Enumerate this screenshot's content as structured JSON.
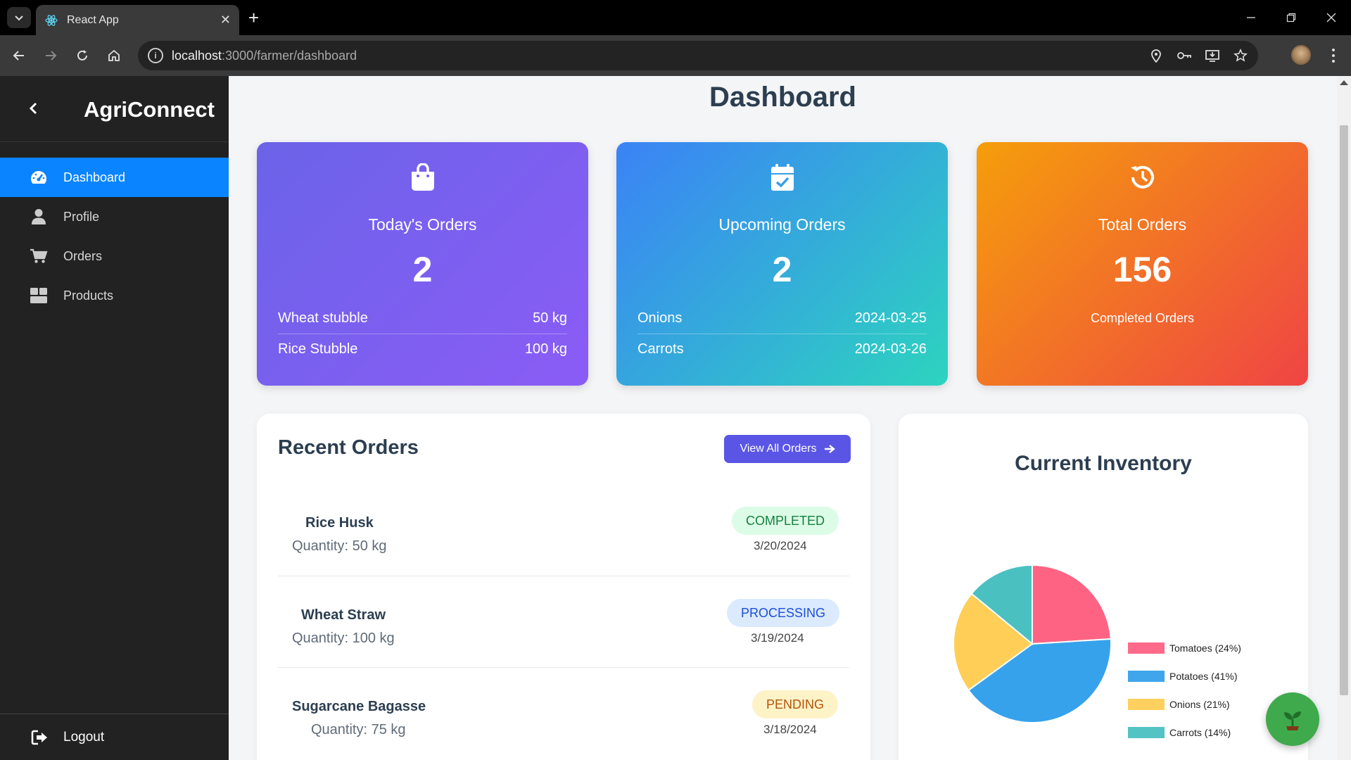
{
  "browser": {
    "tab_title": "React App",
    "url_host": "localhost",
    "url_path": ":3000/farmer/dashboard"
  },
  "sidebar": {
    "brand": "AgriConnect",
    "items": [
      {
        "label": "Dashboard",
        "icon": "gauge-icon",
        "active": true
      },
      {
        "label": "Profile",
        "icon": "user-icon",
        "active": false
      },
      {
        "label": "Orders",
        "icon": "cart-icon",
        "active": false
      },
      {
        "label": "Products",
        "icon": "boxes-icon",
        "active": false
      }
    ],
    "logout": "Logout"
  },
  "page": {
    "title": "Dashboard"
  },
  "cards": {
    "today": {
      "label": "Today's Orders",
      "value": "2",
      "rows": [
        {
          "left": "Wheat stubble",
          "right": "50 kg"
        },
        {
          "left": "Rice Stubble",
          "right": "100 kg"
        }
      ]
    },
    "upcoming": {
      "label": "Upcoming Orders",
      "value": "2",
      "rows": [
        {
          "left": "Onions",
          "right": "2024-03-25"
        },
        {
          "left": "Carrots",
          "right": "2024-03-26"
        }
      ]
    },
    "total": {
      "label": "Total Orders",
      "value": "156",
      "sub": "Completed Orders"
    }
  },
  "recent_orders": {
    "title": "Recent Orders",
    "view_all": "View All Orders",
    "orders": [
      {
        "name": "Rice Husk",
        "quantity": "Quantity: 50 kg",
        "status": "COMPLETED",
        "date": "3/20/2024"
      },
      {
        "name": "Wheat Straw",
        "quantity": "Quantity: 100 kg",
        "status": "PROCESSING",
        "date": "3/19/2024"
      },
      {
        "name": "Sugarcane Bagasse",
        "quantity": "Quantity: 75 kg",
        "status": "PENDING",
        "date": "3/18/2024"
      }
    ]
  },
  "inventory": {
    "title": "Current Inventory"
  },
  "colors": {
    "accent": "#0a84ff",
    "completed_bg": "#dcfce7",
    "completed_fg": "#15803d",
    "processing_bg": "#dbeafe",
    "processing_fg": "#1d4ed8",
    "pending_bg": "#fef3c7",
    "pending_fg": "#b45309"
  },
  "chart_data": {
    "type": "pie",
    "title": "Current Inventory",
    "categories": [
      "Tomatoes (24%)",
      "Potatoes (41%)",
      "Onions (21%)",
      "Carrots (14%)"
    ],
    "values": [
      24,
      41,
      21,
      14
    ],
    "colors": [
      "#ff6384",
      "#36a2eb",
      "#ffce56",
      "#4bc0c0"
    ],
    "legend": "right"
  }
}
